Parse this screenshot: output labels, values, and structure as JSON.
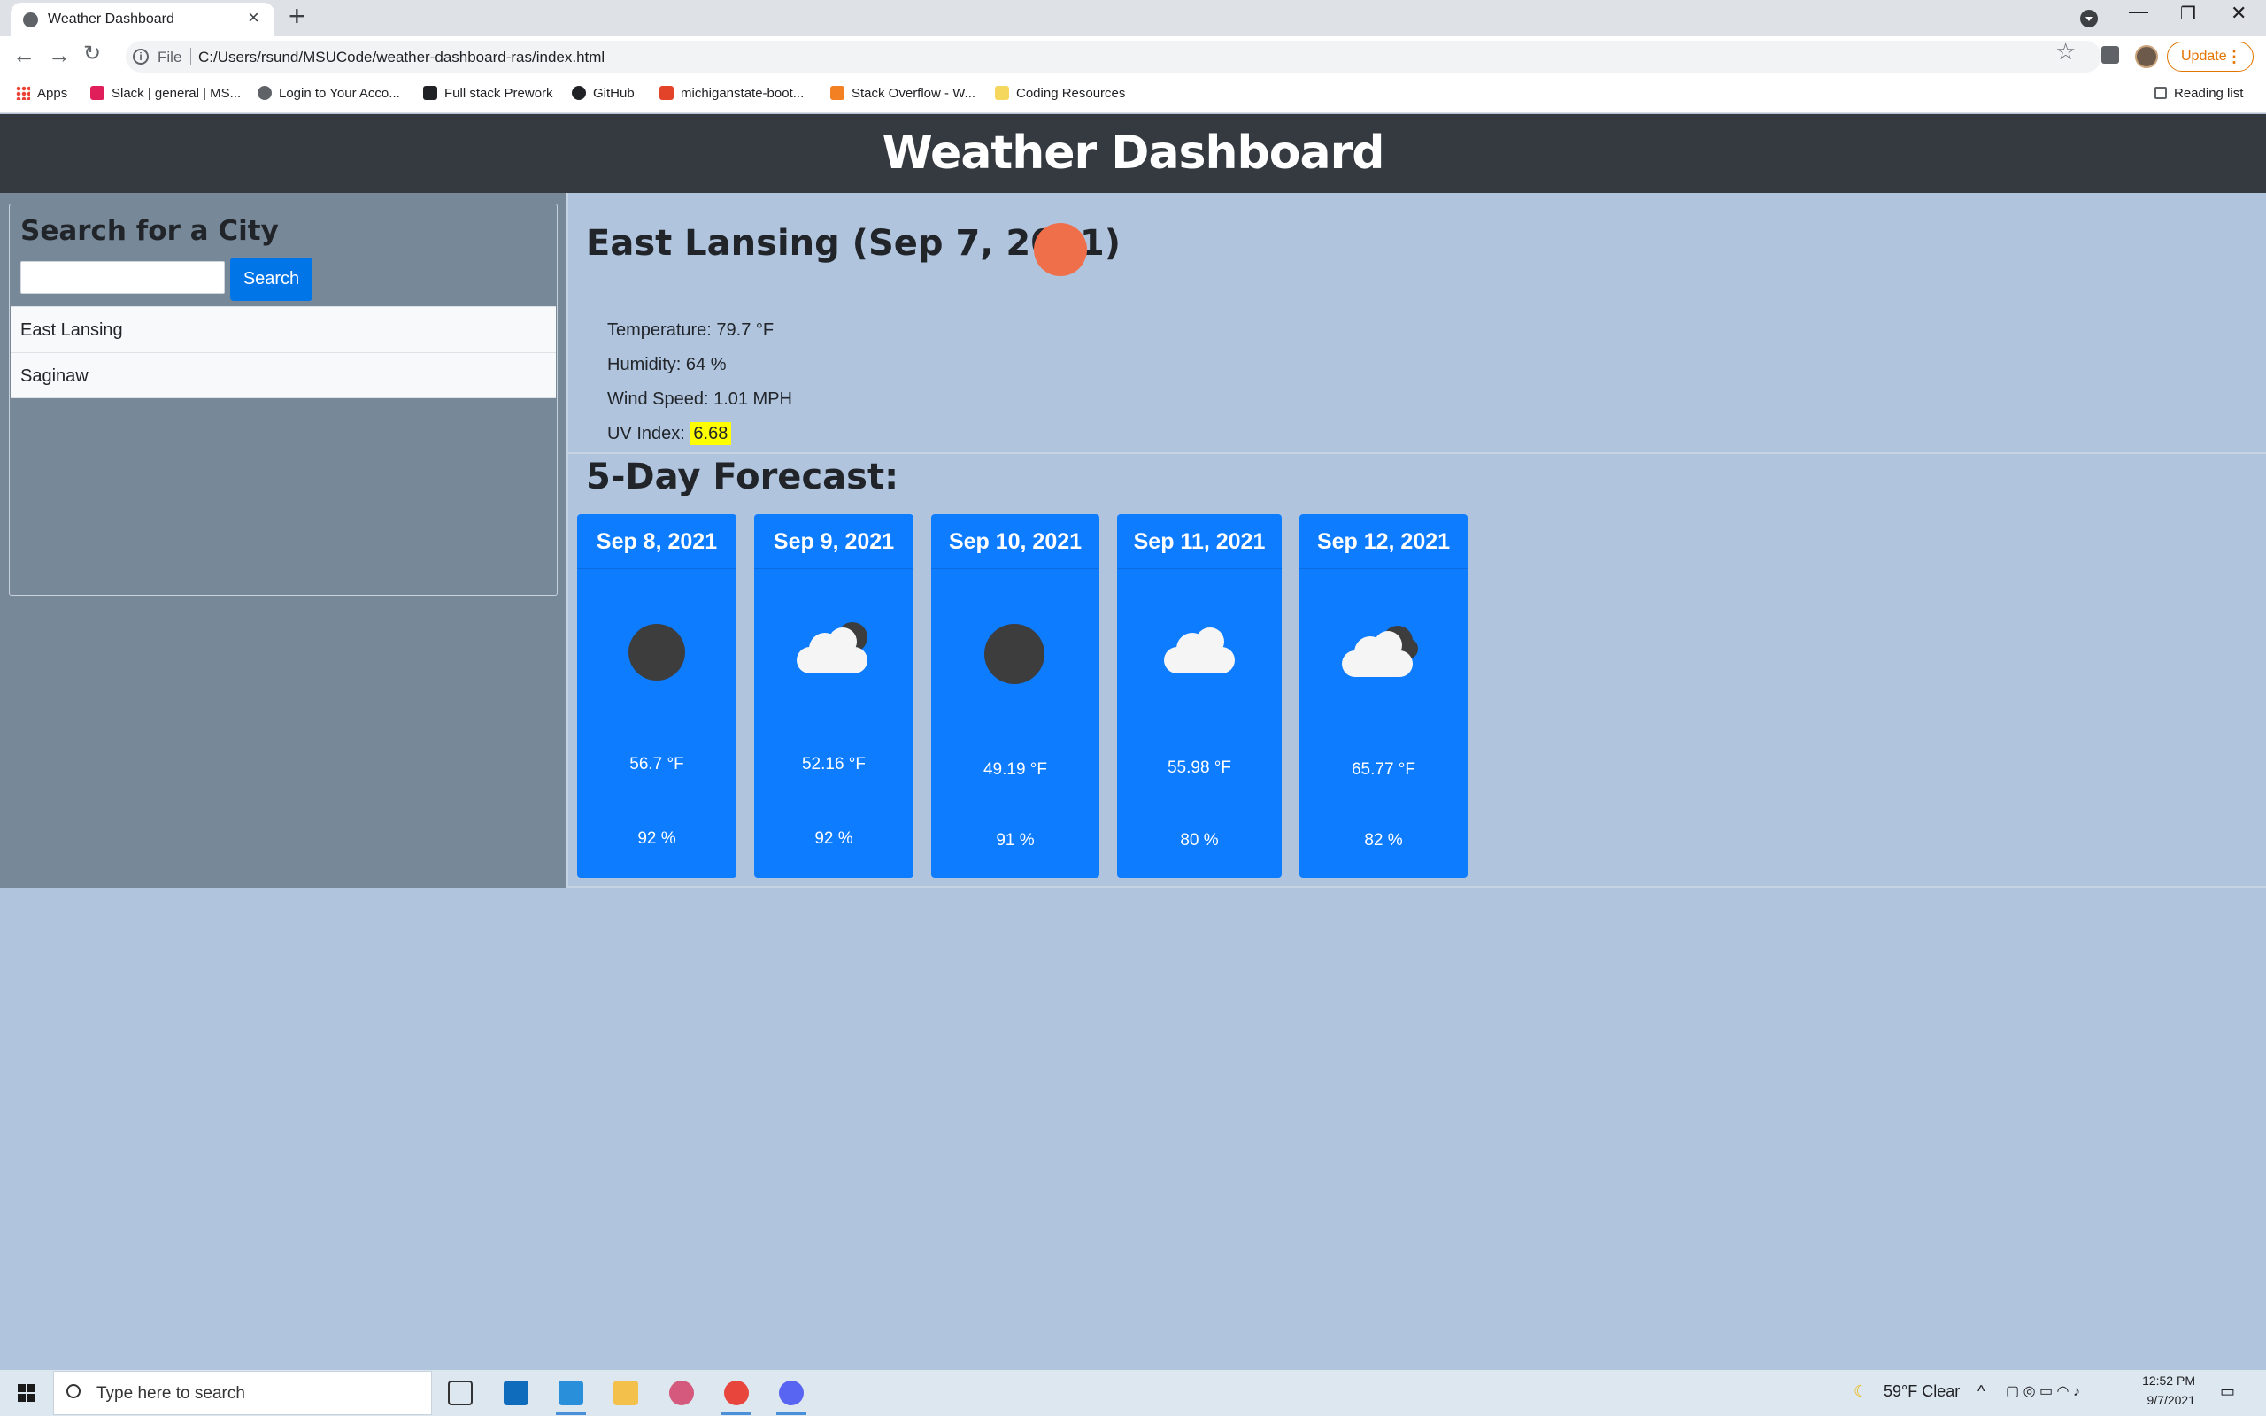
{
  "browser": {
    "tab_title": "Weather Dashboard",
    "tab_close": "×",
    "new_tab": "+",
    "file_label": "File",
    "url": "C:/Users/rsund/MSUCode/weather-dashboard-ras/index.html",
    "update_label": "Update",
    "bookmarks": [
      {
        "label": "Apps",
        "icon": "apps-icon"
      },
      {
        "label": "Slack | general | MS...",
        "icon": "slack-icon",
        "color": "#e01e5a"
      },
      {
        "label": "Login to Your Acco...",
        "icon": "globe-icon",
        "color": "#5f6368"
      },
      {
        "label": "Full stack Prework",
        "icon": "book-icon",
        "color": "#202124"
      },
      {
        "label": "GitHub",
        "icon": "github-icon",
        "color": "#202124"
      },
      {
        "label": "michiganstate-boot...",
        "icon": "gitlab-icon",
        "color": "#e24329"
      },
      {
        "label": "Stack Overflow - W...",
        "icon": "stackoverflow-icon",
        "color": "#f48024"
      },
      {
        "label": "Coding Resources",
        "icon": "folder-icon",
        "color": "#f6d75e"
      }
    ],
    "reading_list": "Reading list"
  },
  "page": {
    "title": "Weather Dashboard"
  },
  "sidebar": {
    "search_title": "Search for a City",
    "search_value": "",
    "search_button": "Search",
    "cities": [
      "East Lansing",
      "Saginaw"
    ]
  },
  "current": {
    "heading": "East Lansing (Sep 7, 2021)",
    "icon": "sun-icon",
    "temperature": "Temperature: 79.7 °F",
    "humidity": "Humidity: 64 %",
    "wind": "Wind Speed: 1.01 MPH",
    "uv_label": "UV Index:",
    "uv_value": "6.68",
    "uv_color": "#ffff00"
  },
  "forecast": {
    "title": "5-Day Forecast:",
    "days": [
      {
        "date": "Sep 8, 2021",
        "icon": "moon-icon",
        "temp": "56.7 °F",
        "humidity": "92 %"
      },
      {
        "date": "Sep 9, 2021",
        "icon": "cloud-moon-icon",
        "temp": "52.16 °F",
        "humidity": "92 %"
      },
      {
        "date": "Sep 10, 2021",
        "icon": "moon-icon",
        "temp": "49.19 °F",
        "humidity": "91 %"
      },
      {
        "date": "Sep 11, 2021",
        "icon": "cloud-icon",
        "temp": "55.98 °F",
        "humidity": "80 %"
      },
      {
        "date": "Sep 12, 2021",
        "icon": "broken-clouds-icon",
        "temp": "65.77 °F",
        "humidity": "82 %"
      }
    ],
    "card_color": "#0d7cff"
  },
  "taskbar": {
    "search_placeholder": "Type here to search",
    "weather": "59°F  Clear",
    "time": "12:52 PM",
    "date": "9/7/2021"
  }
}
